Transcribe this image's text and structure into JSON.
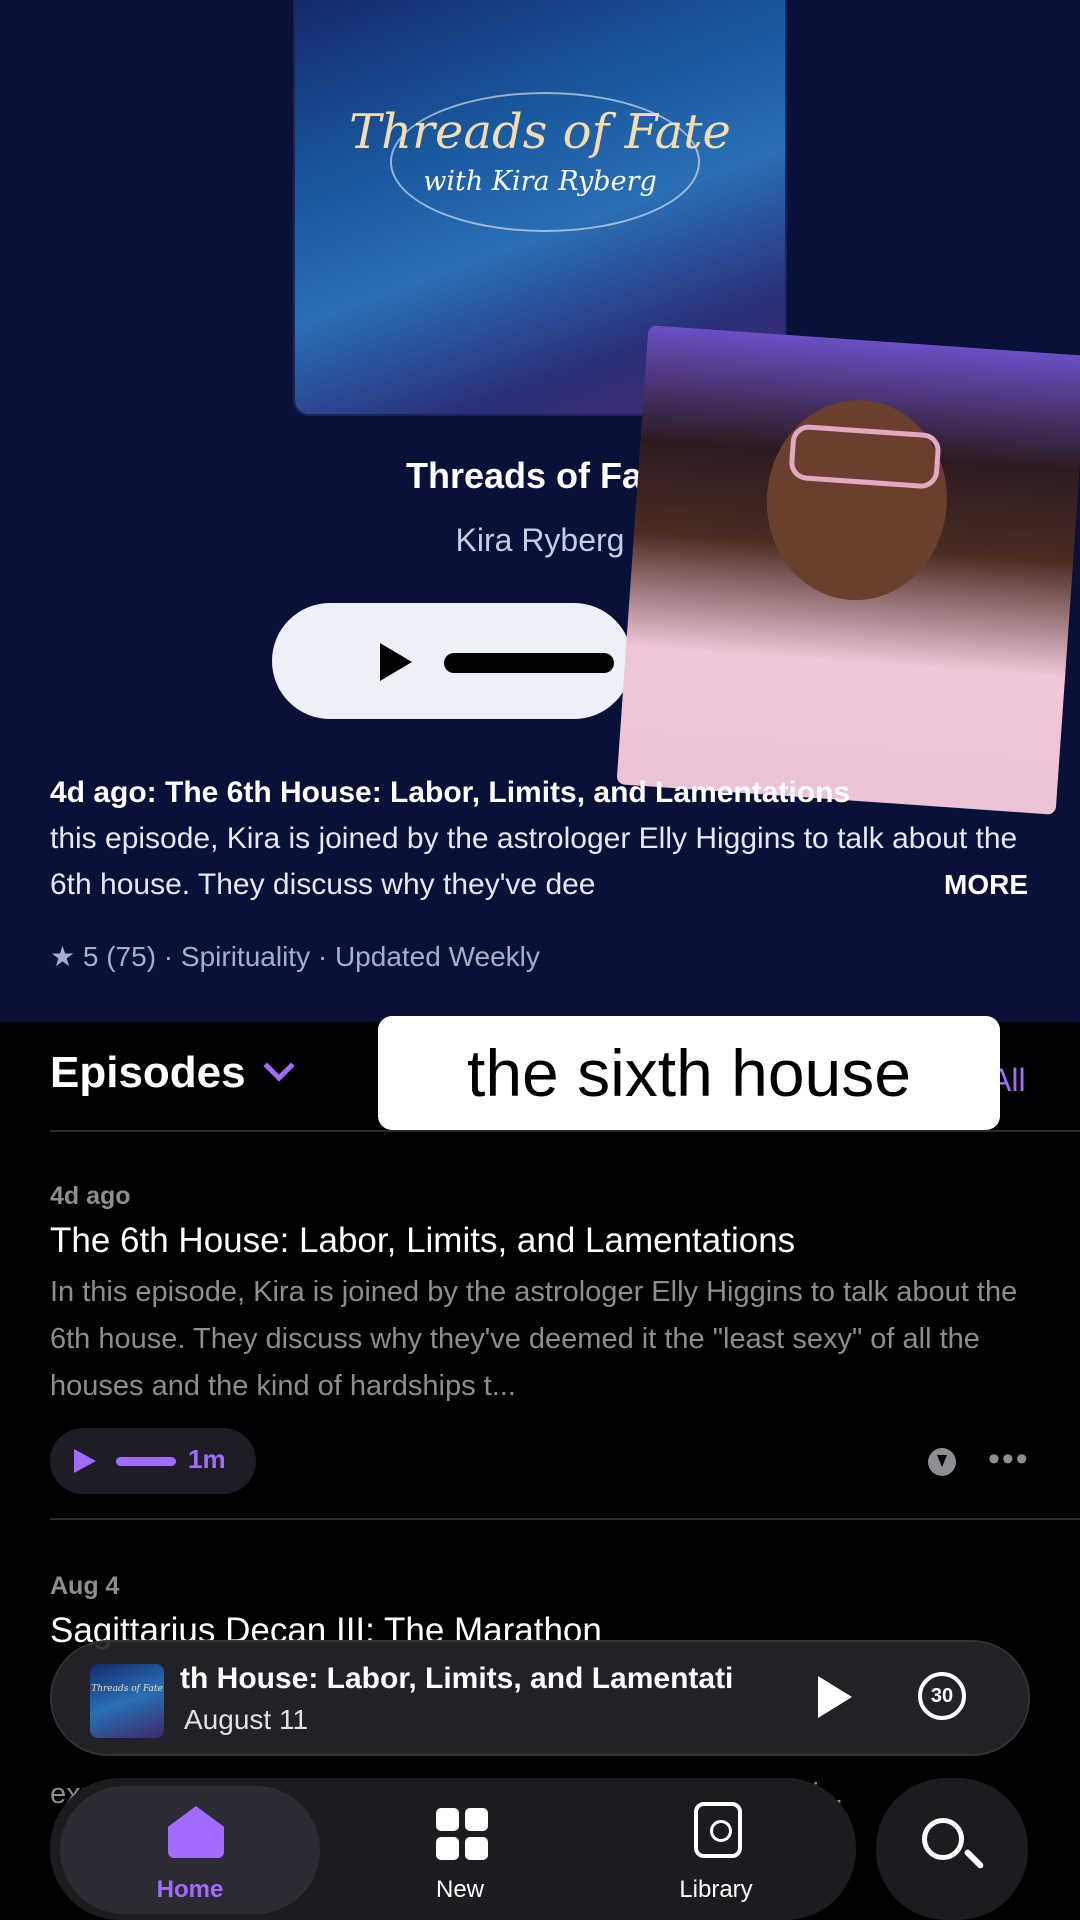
{
  "artwork": {
    "title": "Threads of Fate",
    "subtitle": "with Kira Ryberg"
  },
  "show": {
    "title": "Threads of Fate",
    "author": "Kira Ryberg"
  },
  "latest": {
    "headline": "4d ago: The 6th House: Labor, Limits, and Lamentations",
    "description": "this episode, Kira is joined by the astrologer Elly Higgins to talk about the 6th house. They discuss why they've dee",
    "more_label": "MORE"
  },
  "meta": {
    "rating": "★ 5 (75) · Spirituality · Updated Weekly"
  },
  "episodes": {
    "header": "Episodes",
    "see_all": "All",
    "items": [
      {
        "date": "4d ago",
        "title": "The 6th House: Labor, Limits, and Lamentations",
        "description": "In this episode, Kira is joined by the astrologer Elly Higgins to talk about the 6th house. They discuss why they've deemed it the \"least sexy\" of all the houses and the kind of hardships t...",
        "duration": "1m"
      },
      {
        "date": "Aug 4",
        "title": "Sagittarius Decan III: The Marathon",
        "description": "explore how this decan defies Sagittarius stereotypes, how i..."
      }
    ]
  },
  "caption": "the sixth house",
  "mini_player": {
    "title": "th House: Labor, Limits, and Lamentati",
    "date": "August 11",
    "thumb_text": "Threads of Fate",
    "skip_label": "30"
  },
  "tabs": [
    {
      "label": "Home",
      "icon": "house-icon",
      "active": true
    },
    {
      "label": "New",
      "icon": "grid-icon"
    },
    {
      "label": "Library",
      "icon": "library-icon"
    }
  ],
  "colors": {
    "accent": "#a26bff",
    "hero_bg": "#0a1138"
  }
}
